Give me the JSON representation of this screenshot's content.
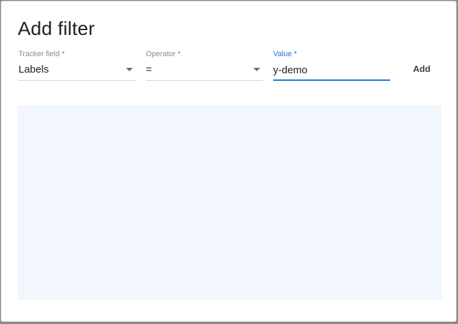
{
  "dialog": {
    "title": "Add filter",
    "add_label": "Add"
  },
  "fields": {
    "tracker": {
      "label": "Tracker field *",
      "value": "Labels"
    },
    "operator": {
      "label": "Operator *",
      "value": "="
    },
    "value": {
      "label": "Value *",
      "value": "y-demo"
    }
  },
  "colors": {
    "accent": "#1976d2",
    "panel_background": "#f2f6fd"
  }
}
